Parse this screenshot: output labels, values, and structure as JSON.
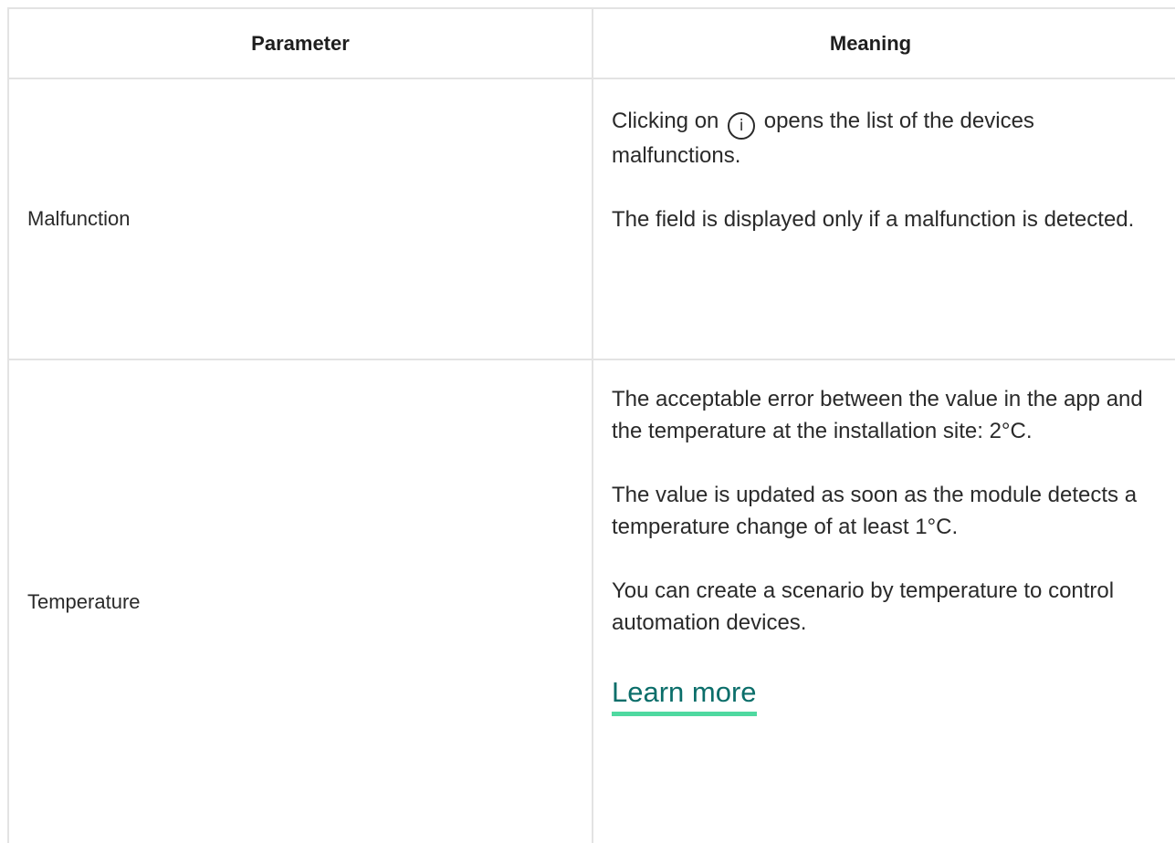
{
  "table": {
    "headers": {
      "parameter": "Parameter",
      "meaning": "Meaning"
    },
    "rows": [
      {
        "parameter": "Malfunction",
        "meaning": {
          "p1_before_icon": "Clicking on",
          "icon": "info-icon",
          "icon_glyph": "i",
          "p1_after_icon": "opens the list of the devices malfunctions.",
          "p2": "The field is displayed only if a malfunction is detected."
        }
      },
      {
        "parameter": "Temperature",
        "meaning": {
          "p1": "The acceptable error between the value in the app and the temperature at the installation site: 2°C.",
          "p2": "The value is updated as soon as the module detects a temperature change of at least 1°C.",
          "p3": "You can create a scenario by temperature to control automation devices.",
          "link": "Learn more"
        }
      }
    ]
  },
  "colors": {
    "text": "#2a2a2a",
    "border": "#e3e3e3",
    "link": "#0b6e6a",
    "link_underline": "#4fd9a0"
  }
}
